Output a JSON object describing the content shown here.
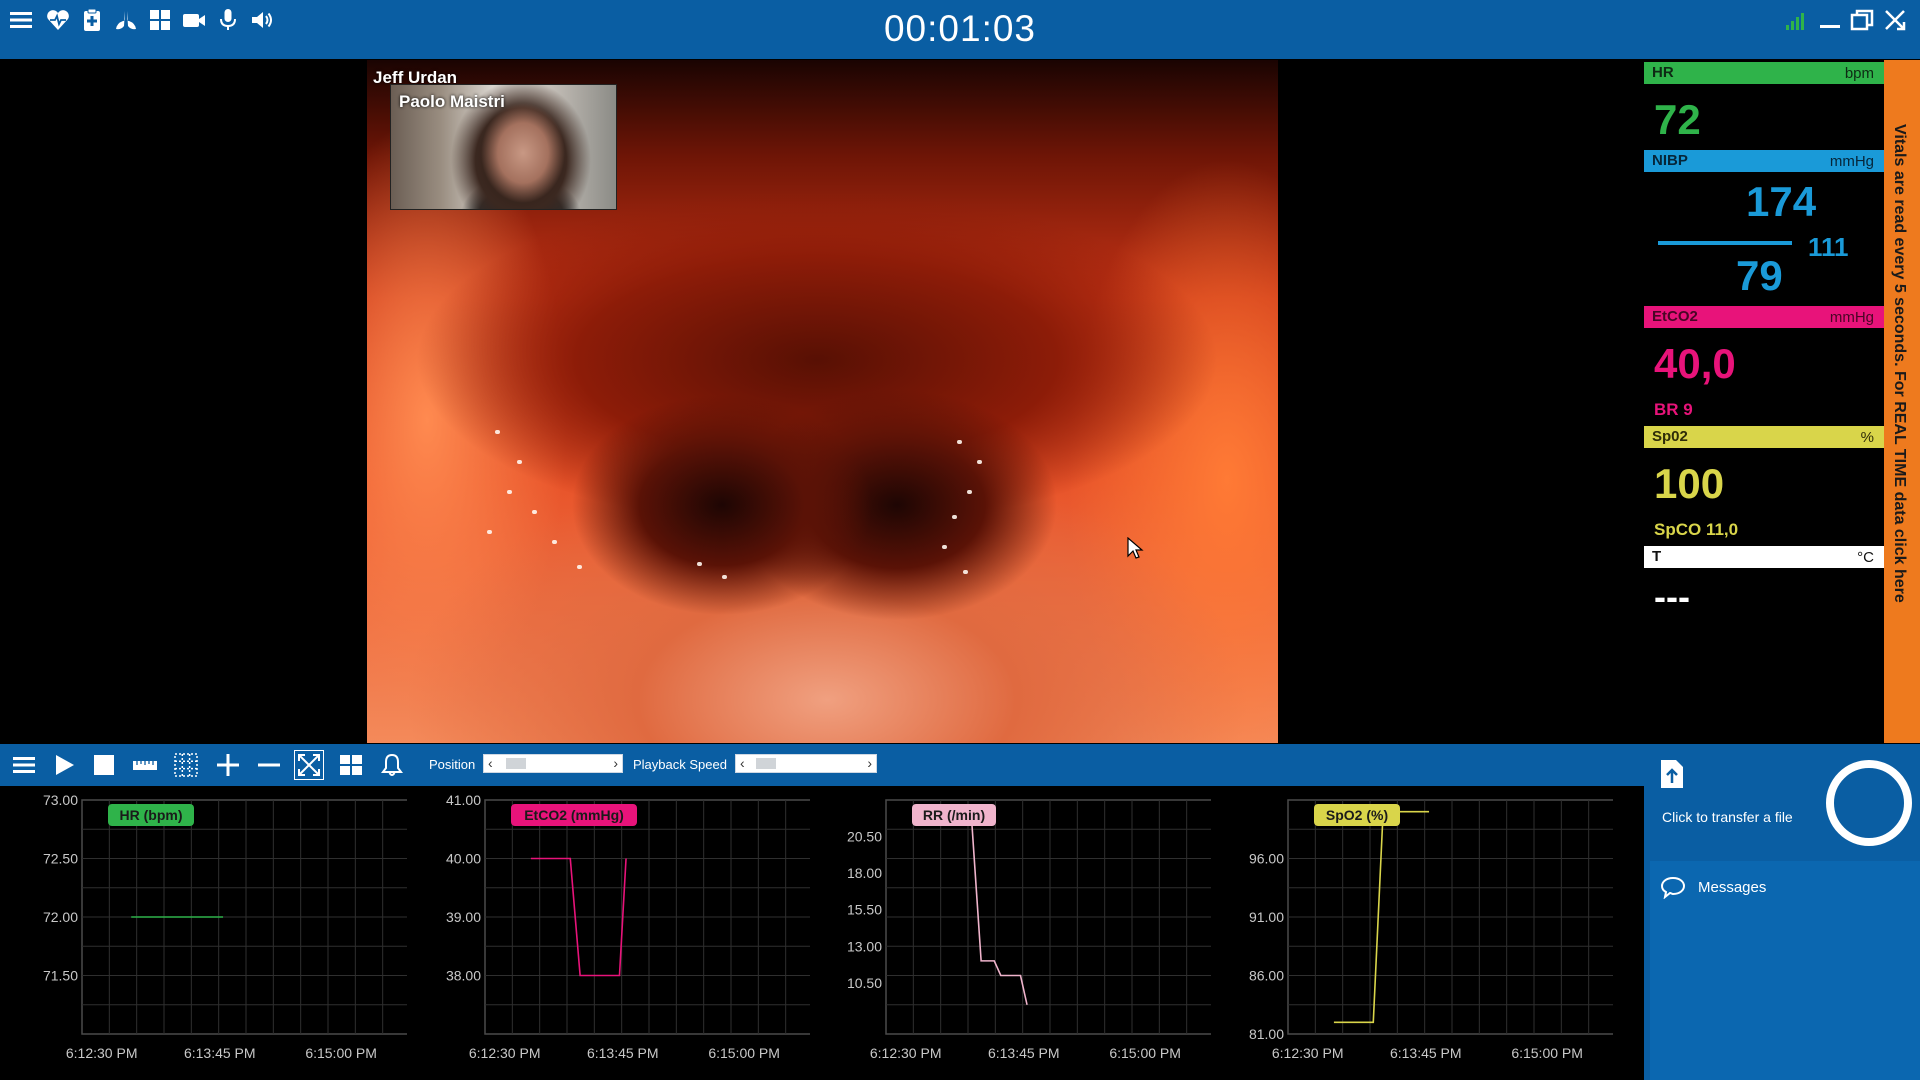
{
  "timer": "00:01:03",
  "toolbar_icons": [
    "menu-icon",
    "heart-icon",
    "clipboard-icon",
    "lungs-icon",
    "grid-icon",
    "camera-icon",
    "microphone-icon",
    "speaker-icon"
  ],
  "video": {
    "main_participant": "Jeff Urdan",
    "pip_participant": "Paolo Maistri"
  },
  "vitals": {
    "hr": {
      "label": "HR",
      "unit": "bpm",
      "value": "72",
      "color": "#2fb34a"
    },
    "nibp": {
      "label": "NIBP",
      "unit": "mmHg",
      "systolic": "174",
      "diastolic": "79",
      "mean": "111",
      "color": "#1a9ad8"
    },
    "etco2": {
      "label": "EtCO2",
      "unit": "mmHg",
      "value": "40,0",
      "sub": "BR 9",
      "color": "#e8137a"
    },
    "spo2": {
      "label": "Sp02",
      "unit": "%",
      "value": "100",
      "sub": "SpCO 11,0",
      "color": "#d9d54a"
    },
    "temp": {
      "label": "T",
      "unit": "°C",
      "value": "---"
    },
    "banner": "Vitals are read every 5 seconds. For REAL TIME data click here"
  },
  "playback": {
    "position_label": "Position",
    "speed_label": "Playback Speed"
  },
  "side": {
    "transfer_label": "Click to transfer a file",
    "messages_label": "Messages"
  },
  "chart_data": [
    {
      "type": "line",
      "title": "HR (bpm)",
      "color": "#2fb34a",
      "ylim": [
        71.0,
        73.0
      ],
      "yticks": [
        "73.00",
        "72.50",
        "72.00",
        "71.50"
      ],
      "xticks": [
        "6:12:30 PM",
        "6:13:45 PM",
        "6:15:00 PM"
      ],
      "series": [
        {
          "x": [
            0.15,
            0.43
          ],
          "values": [
            72.0,
            72.0
          ]
        }
      ]
    },
    {
      "type": "line",
      "title": "EtCO2 (mmHg)",
      "color": "#e8137a",
      "ylim": [
        37.0,
        41.0
      ],
      "yticks": [
        "41.00",
        "40.00",
        "39.00",
        "38.00"
      ],
      "xticks": [
        "6:12:30 PM",
        "6:13:45 PM",
        "6:15:00 PM"
      ],
      "series": [
        {
          "x": [
            0.14,
            0.26,
            0.29,
            0.41,
            0.43
          ],
          "values": [
            40.0,
            40.0,
            38.0,
            38.0,
            40.0
          ]
        }
      ]
    },
    {
      "type": "line",
      "title": "RR (/min)",
      "color": "#f0b4cc",
      "ylim": [
        7.0,
        23.0
      ],
      "yticks": [
        "20.50",
        "18.00",
        "15.50",
        "13.00",
        "10.50"
      ],
      "xticks": [
        "6:12:30 PM",
        "6:13:45 PM",
        "6:15:00 PM"
      ],
      "series": [
        {
          "x": [
            0.26,
            0.29,
            0.33,
            0.35,
            0.41,
            0.43
          ],
          "values": [
            22.0,
            12.0,
            12.0,
            11.0,
            11.0,
            9.0
          ]
        }
      ]
    },
    {
      "type": "line",
      "title": "SpO2 (%)",
      "color": "#d9d54a",
      "ylim": [
        81.0,
        101.0
      ],
      "yticks": [
        "96.00",
        "91.00",
        "86.00",
        "81.00"
      ],
      "xticks": [
        "6:12:30 PM",
        "6:13:45 PM",
        "6:15:00 PM"
      ],
      "series": [
        {
          "x": [
            0.14,
            0.26,
            0.29,
            0.43
          ],
          "values": [
            82.0,
            82.0,
            100.0,
            100.0
          ]
        }
      ]
    }
  ]
}
